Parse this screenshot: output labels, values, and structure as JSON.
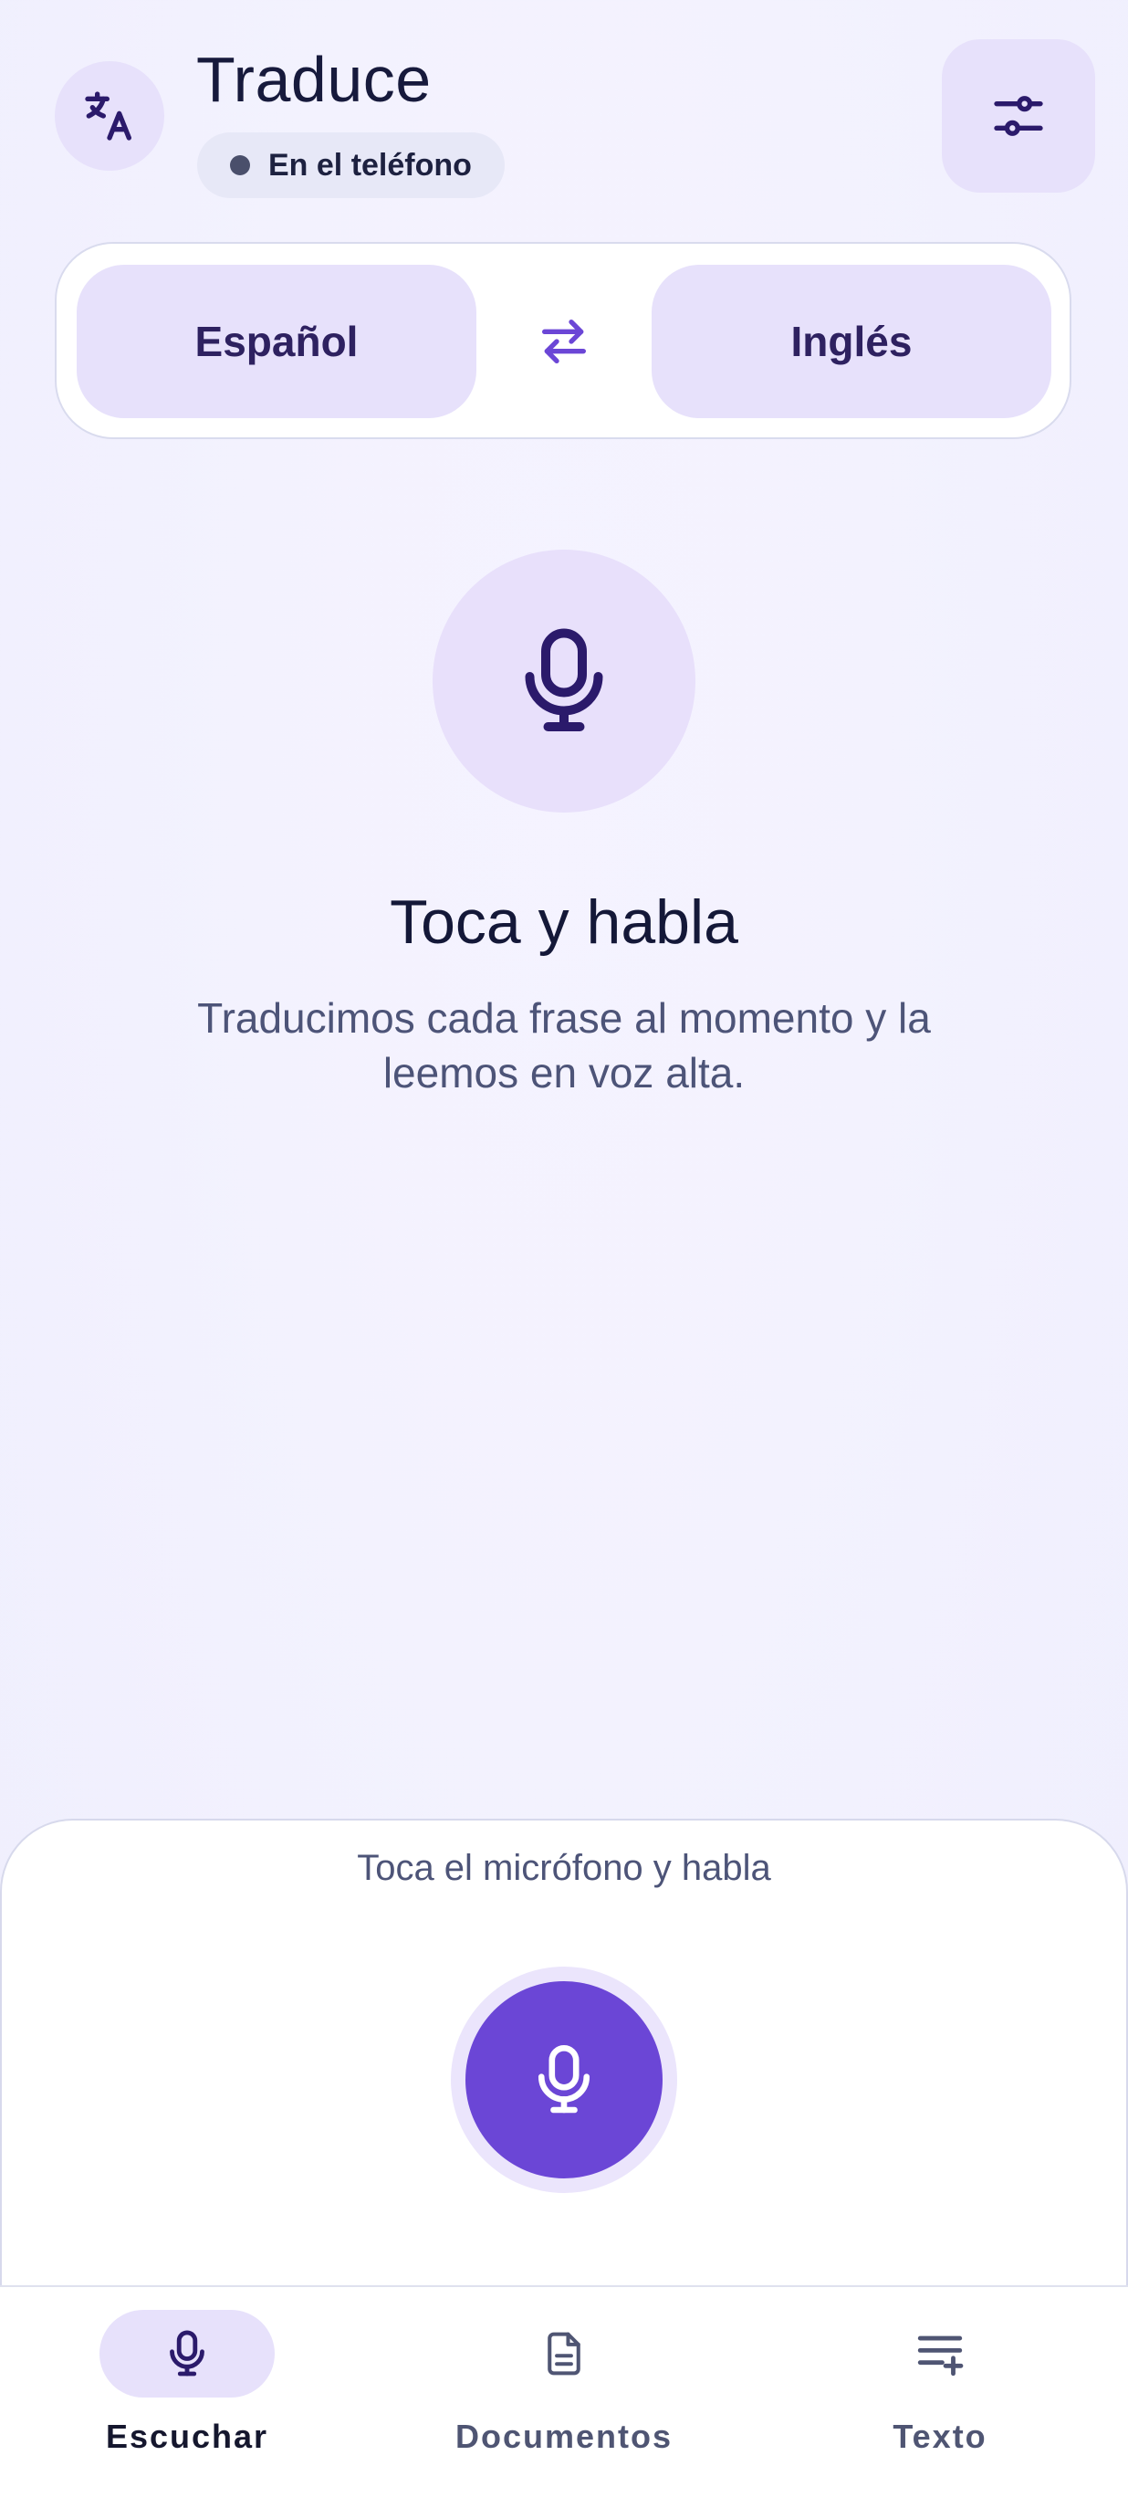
{
  "header": {
    "title": "Traduce",
    "status_text": "En el teléfono",
    "logo_icon": "translate-icon",
    "settings_icon": "sliders-icon"
  },
  "languages": {
    "source": "Español",
    "target": "Inglés",
    "swap_icon": "swap-arrows-icon"
  },
  "hero": {
    "title": "Toca y habla",
    "subtitle": "Traducimos cada frase al momento y la leemos en voz alta.",
    "icon": "microphone-icon"
  },
  "sheet": {
    "hint": "Toca el micrófono y habla",
    "record_icon": "microphone-icon"
  },
  "nav": {
    "items": [
      {
        "label": "Escuchar",
        "icon": "microphone-icon",
        "active": true
      },
      {
        "label": "Documentos",
        "icon": "document-icon",
        "active": false
      },
      {
        "label": "Texto",
        "icon": "text-add-icon",
        "active": false
      }
    ]
  },
  "colors": {
    "accent": "#6b46d6",
    "accent_soft": "#e7e1fb",
    "text_primary": "#161a3a",
    "text_secondary": "#4d5478"
  }
}
